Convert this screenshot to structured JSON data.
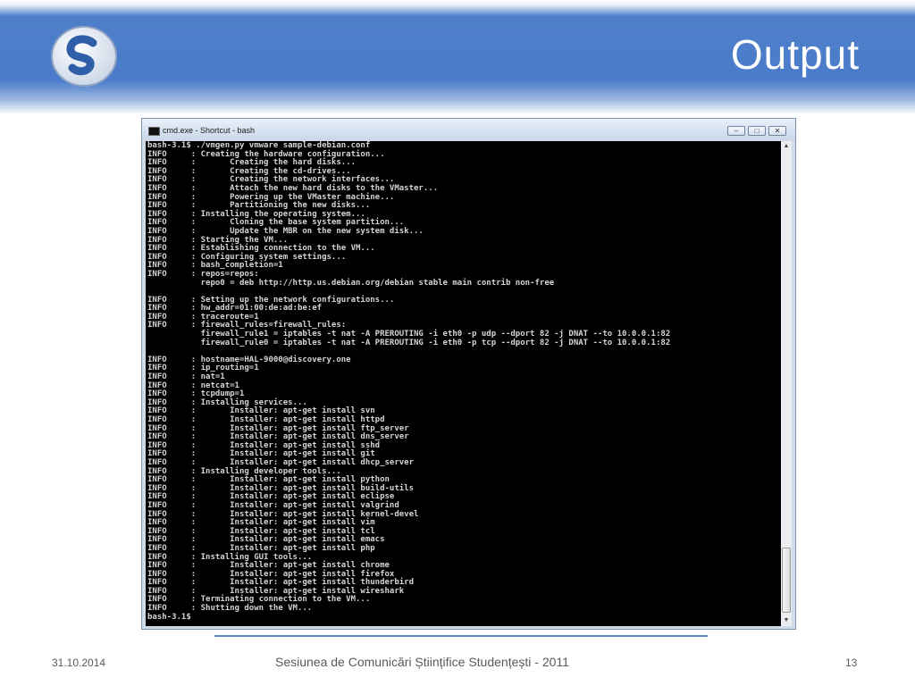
{
  "slide": {
    "title": "Output",
    "footer_date": "31.10.2014",
    "footer_center": "Sesiunea de Comunicări Științifice Studențești - 2011",
    "page_number": "13",
    "logo_icon": "s-logo-icon",
    "accent_color": "#4a7ccb"
  },
  "window": {
    "title": "cmd.exe - Shortcut - bash",
    "minimize_label": "–",
    "maximize_label": "□",
    "close_label": "✕",
    "scroll_up": "▲",
    "scroll_down": "▼"
  },
  "terminal": {
    "lines": [
      "bash-3.1$ ./vmgen.py vmware sample-debian.conf",
      "INFO     : Creating the hardware configuration...",
      "INFO     :       Creating the hard disks...",
      "INFO     :       Creating the cd-drives...",
      "INFO     :       Creating the network interfaces...",
      "INFO     :       Attach the new hard disks to the VMaster...",
      "INFO     :       Powering up the VMaster machine...",
      "INFO     :       Partitioning the new disks...",
      "INFO     : Installing the operating system...",
      "INFO     :       Cloning the base system partition...",
      "INFO     :       Update the MBR on the new system disk...",
      "INFO     : Starting the VM...",
      "INFO     : Establishing connection to the VM...",
      "INFO     : Configuring system settings...",
      "INFO     : bash_completion=1",
      "INFO     : repos=repos:",
      "           repo0 = deb http://http.us.debian.org/debian stable main contrib non-free",
      "",
      "INFO     : Setting up the network configurations...",
      "INFO     : hw_addr=01:00:de:ad:be:ef",
      "INFO     : traceroute=1",
      "INFO     : firewall_rules=firewall_rules:",
      "           firewall_rule1 = iptables -t nat -A PREROUTING -i eth0 -p udp --dport 82 -j DNAT --to 10.0.0.1:82",
      "           firewall_rule0 = iptables -t nat -A PREROUTING -i eth0 -p tcp --dport 82 -j DNAT --to 10.0.0.1:82",
      "",
      "INFO     : hostname=HAL-9000@discovery.one",
      "INFO     : ip_routing=1",
      "INFO     : nat=1",
      "INFO     : netcat=1",
      "INFO     : tcpdump=1",
      "INFO     : Installing services...",
      "INFO     :       Installer: apt-get install svn",
      "INFO     :       Installer: apt-get install httpd",
      "INFO     :       Installer: apt-get install ftp_server",
      "INFO     :       Installer: apt-get install dns_server",
      "INFO     :       Installer: apt-get install sshd",
      "INFO     :       Installer: apt-get install git",
      "INFO     :       Installer: apt-get install dhcp_server",
      "INFO     : Installing developer tools...",
      "INFO     :       Installer: apt-get install python",
      "INFO     :       Installer: apt-get install build-utils",
      "INFO     :       Installer: apt-get install eclipse",
      "INFO     :       Installer: apt-get install valgrind",
      "INFO     :       Installer: apt-get install kernel-devel",
      "INFO     :       Installer: apt-get install vim",
      "INFO     :       Installer: apt-get install tcl",
      "INFO     :       Installer: apt-get install emacs",
      "INFO     :       Installer: apt-get install php",
      "INFO     : Installing GUI tools...",
      "INFO     :       Installer: apt-get install chrome",
      "INFO     :       Installer: apt-get install firefox",
      "INFO     :       Installer: apt-get install thunderbird",
      "INFO     :       Installer: apt-get install wireshark",
      "INFO     : Terminating connection to the VM...",
      "INFO     : Shutting down the VM...",
      "bash-3.1$"
    ]
  }
}
